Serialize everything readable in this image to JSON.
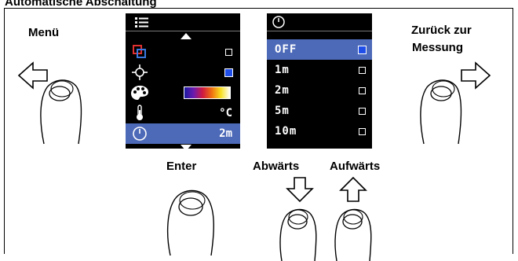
{
  "title": "Automatische Abschaltung",
  "labels": {
    "menu": "Menü",
    "back_line1": "Zurück zur",
    "back_line2": "Messung",
    "enter": "Enter",
    "down": "Abwärts",
    "up": "Aufwärts"
  },
  "menu_screen": {
    "header_icon": "list-icon",
    "rows": [
      {
        "icon": "palette-overlay-icon",
        "control": "checkbox",
        "checked": false
      },
      {
        "icon": "crosshair-icon",
        "control": "checkbox",
        "checked": true
      },
      {
        "icon": "color-palette-icon",
        "control": "gradient-bar"
      },
      {
        "icon": "thermometer-icon",
        "value": "°C"
      },
      {
        "icon": "clock-icon",
        "value": "2m",
        "selected": true
      }
    ]
  },
  "timeout_screen": {
    "header_icon": "clock-icon",
    "options": [
      {
        "label": "OFF",
        "checked": true,
        "selected": true
      },
      {
        "label": "1m",
        "checked": false
      },
      {
        "label": "2m",
        "checked": false
      },
      {
        "label": "5m",
        "checked": false
      },
      {
        "label": "10m",
        "checked": false
      }
    ]
  },
  "colors": {
    "selection": "#4d6ab8",
    "checkbox_on": "#1f4fe8",
    "screen_bg": "#000000"
  }
}
